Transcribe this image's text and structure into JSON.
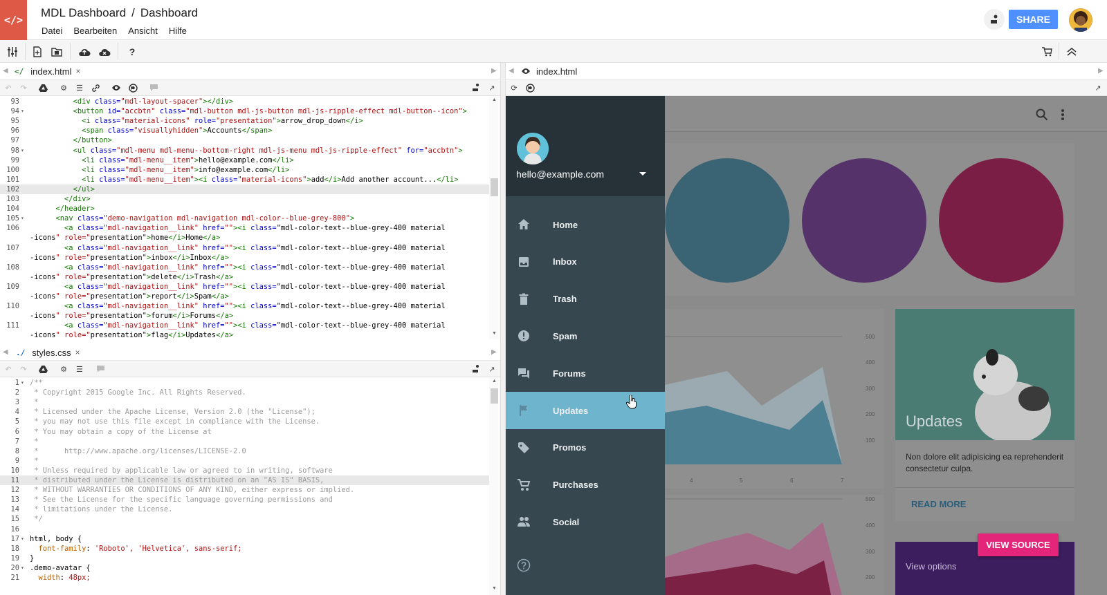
{
  "app": {
    "logo_glyph": "</>",
    "project": "MDL Dashboard",
    "separator": "/",
    "file": "Dashboard",
    "menus": [
      "Datei",
      "Bearbeiten",
      "Ansicht",
      "Hilfe"
    ],
    "share_label": "SHARE",
    "help_glyph": "?"
  },
  "editor_top": {
    "tab_label": "index.html",
    "tab_close": "×",
    "lines": [
      {
        "n": "93",
        "fold": "",
        "t": "          <div class=\"mdl-layout-spacer\"></div>"
      },
      {
        "n": "94",
        "fold": "▾",
        "t": "          <button id=\"accbtn\" class=\"mdl-button mdl-js-button mdl-js-ripple-effect mdl-button--icon\">"
      },
      {
        "n": "95",
        "fold": "",
        "t": "            <i class=\"material-icons\" role=\"presentation\">arrow_drop_down</i>"
      },
      {
        "n": "96",
        "fold": "",
        "t": "            <span class=\"visuallyhidden\">Accounts</span>"
      },
      {
        "n": "97",
        "fold": "",
        "t": "          </button>"
      },
      {
        "n": "98",
        "fold": "▾",
        "t": "          <ul class=\"mdl-menu mdl-menu--bottom-right mdl-js-menu mdl-js-ripple-effect\" for=\"accbtn\">"
      },
      {
        "n": "99",
        "fold": "",
        "t": "            <li class=\"mdl-menu__item\">hello@example.com</li>"
      },
      {
        "n": "100",
        "fold": "",
        "t": "            <li class=\"mdl-menu__item\">info@example.com</li>"
      },
      {
        "n": "101",
        "fold": "",
        "t": "            <li class=\"mdl-menu__item\"><i class=\"material-icons\">add</i>Add another account...</li>"
      },
      {
        "n": "102",
        "fold": "",
        "t": "          </ul>",
        "hl": true
      },
      {
        "n": "103",
        "fold": "",
        "t": "        </div>"
      },
      {
        "n": "104",
        "fold": "",
        "t": "      </header>"
      },
      {
        "n": "105",
        "fold": "▾",
        "t": "      <nav class=\"demo-navigation mdl-navigation mdl-color--blue-grey-800\">"
      },
      {
        "n": "106",
        "fold": "",
        "t": "        <a class=\"mdl-navigation__link\" href=\"\"><i class=\"mdl-color-text--blue-grey-400 material"
      },
      {
        "n": "",
        "fold": "",
        "t": "-icons\" role=\"presentation\">home</i>Home</a>"
      },
      {
        "n": "107",
        "fold": "",
        "t": "        <a class=\"mdl-navigation__link\" href=\"\"><i class=\"mdl-color-text--blue-grey-400 material"
      },
      {
        "n": "",
        "fold": "",
        "t": "-icons\" role=\"presentation\">inbox</i>Inbox</a>"
      },
      {
        "n": "108",
        "fold": "",
        "t": "        <a class=\"mdl-navigation__link\" href=\"\"><i class=\"mdl-color-text--blue-grey-400 material"
      },
      {
        "n": "",
        "fold": "",
        "t": "-icons\" role=\"presentation\">delete</i>Trash</a>"
      },
      {
        "n": "109",
        "fold": "",
        "t": "        <a class=\"mdl-navigation__link\" href=\"\"><i class=\"mdl-color-text--blue-grey-400 material"
      },
      {
        "n": "",
        "fold": "",
        "t": "-icons\" role=\"presentation\">report</i>Spam</a>"
      },
      {
        "n": "110",
        "fold": "",
        "t": "        <a class=\"mdl-navigation__link\" href=\"\"><i class=\"mdl-color-text--blue-grey-400 material"
      },
      {
        "n": "",
        "fold": "",
        "t": "-icons\" role=\"presentation\">forum</i>Forums</a>"
      },
      {
        "n": "111",
        "fold": "",
        "t": "        <a class=\"mdl-navigation__link\" href=\"\"><i class=\"mdl-color-text--blue-grey-400 material"
      },
      {
        "n": "",
        "fold": "",
        "t": "-icons\" role=\"presentation\">flag</i>Updates</a>"
      }
    ]
  },
  "editor_bottom": {
    "tab_label": "styles.css",
    "tab_close": "×",
    "lines": [
      {
        "n": "1",
        "fold": "▾",
        "t": "/**",
        "k": "cm"
      },
      {
        "n": "2",
        "fold": "",
        "t": " * Copyright 2015 Google Inc. All Rights Reserved.",
        "k": "cm"
      },
      {
        "n": "3",
        "fold": "",
        "t": " *",
        "k": "cm"
      },
      {
        "n": "4",
        "fold": "",
        "t": " * Licensed under the Apache License, Version 2.0 (the \"License\");",
        "k": "cm"
      },
      {
        "n": "5",
        "fold": "",
        "t": " * you may not use this file except in compliance with the License.",
        "k": "cm"
      },
      {
        "n": "6",
        "fold": "",
        "t": " * You may obtain a copy of the License at",
        "k": "cm"
      },
      {
        "n": "7",
        "fold": "",
        "t": " *",
        "k": "cm"
      },
      {
        "n": "8",
        "fold": "",
        "t": " *      http://www.apache.org/licenses/LICENSE-2.0",
        "k": "cm"
      },
      {
        "n": "9",
        "fold": "",
        "t": " *",
        "k": "cm"
      },
      {
        "n": "10",
        "fold": "",
        "t": " * Unless required by applicable law or agreed to in writing, software",
        "k": "cm"
      },
      {
        "n": "11",
        "fold": "",
        "t": " * distributed under the License is distributed on an \"AS IS\" BASIS,",
        "k": "cm",
        "hl": true
      },
      {
        "n": "12",
        "fold": "",
        "t": " * WITHOUT WARRANTIES OR CONDITIONS OF ANY KIND, either express or implied.",
        "k": "cm"
      },
      {
        "n": "13",
        "fold": "",
        "t": " * See the License for the specific language governing permissions and",
        "k": "cm"
      },
      {
        "n": "14",
        "fold": "",
        "t": " * limitations under the License.",
        "k": "cm"
      },
      {
        "n": "15",
        "fold": "",
        "t": " */",
        "k": "cm"
      },
      {
        "n": "16",
        "fold": "",
        "t": "",
        "k": "cm"
      },
      {
        "n": "17",
        "fold": "▾",
        "t": "html, body {",
        "k": "sel"
      },
      {
        "n": "18",
        "fold": "",
        "t": "  font-family: 'Roboto', 'Helvetica', sans-serif;",
        "k": "decl"
      },
      {
        "n": "19",
        "fold": "",
        "t": "}",
        "k": "sel"
      },
      {
        "n": "20",
        "fold": "▾",
        "t": ".demo-avatar {",
        "k": "sel"
      },
      {
        "n": "21",
        "fold": "",
        "t": "  width: 48px;",
        "k": "decl"
      }
    ]
  },
  "preview": {
    "tab_label": "index.html",
    "email": "hello@example.com",
    "nav": [
      {
        "label": "Home",
        "icon": "home-icon"
      },
      {
        "label": "Inbox",
        "icon": "inbox-icon"
      },
      {
        "label": "Trash",
        "icon": "trash-icon"
      },
      {
        "label": "Spam",
        "icon": "spam-icon"
      },
      {
        "label": "Forums",
        "icon": "forum-icon"
      },
      {
        "label": "Updates",
        "icon": "flag-icon",
        "active": true
      },
      {
        "label": "Promos",
        "icon": "tag-icon"
      },
      {
        "label": "Purchases",
        "icon": "cart-icon"
      },
      {
        "label": "Social",
        "icon": "people-icon"
      }
    ],
    "circle_colors": [
      "#3a6373",
      "#55326a",
      "#7b1e45"
    ],
    "chart1_y_ticks": [
      "500",
      "400",
      "300",
      "200",
      "100"
    ],
    "chart1_x_ticks": [
      "4",
      "5",
      "6",
      "7"
    ],
    "chart2_y_ticks": [
      "500",
      "400",
      "300",
      "200"
    ],
    "updates_title": "Updates",
    "updates_text": "Non dolore elit adipisicing ea reprehenderit consectetur culpa.",
    "read_more": "READ MORE",
    "view_options": "View options",
    "view_source": "VIEW SOURCE"
  },
  "colors": {
    "logo_bg": "#de5a46",
    "share_bg": "#4d90fe",
    "drawer_bg": "#37474f",
    "drawer_head_bg": "#263238",
    "active_nav_bg": "#6fb4cd",
    "view_source_bg": "#e3267a"
  }
}
